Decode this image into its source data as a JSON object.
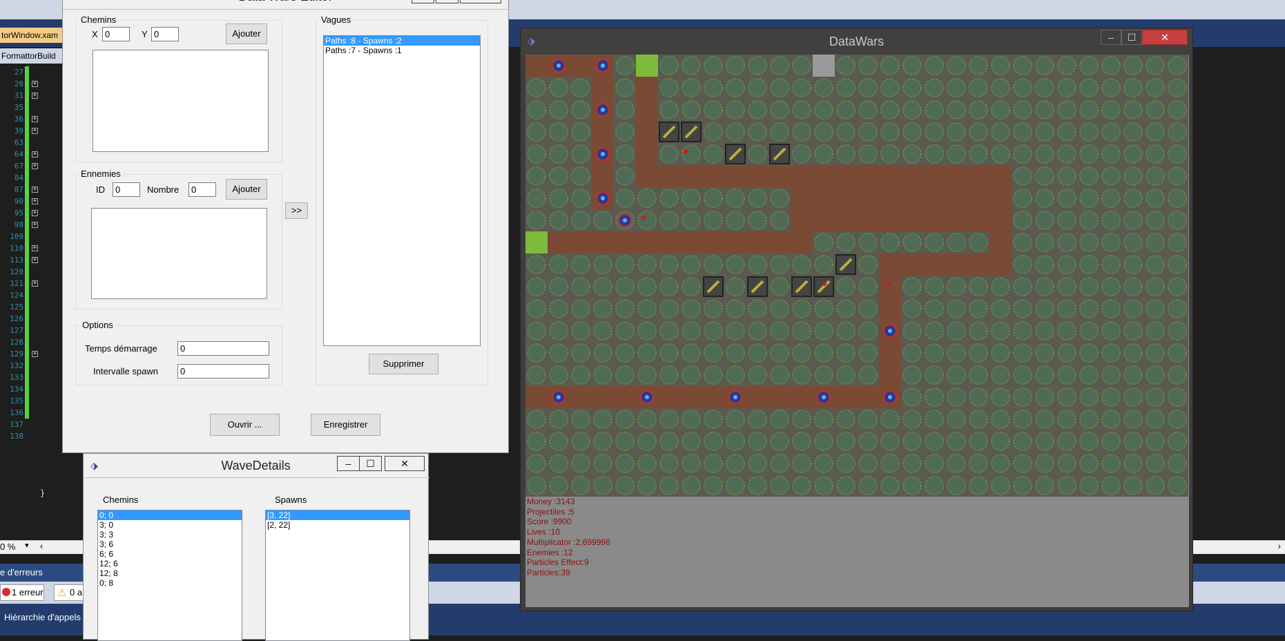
{
  "ide": {
    "tabs": [
      "torWindow.xam",
      "FormattorBuild"
    ],
    "line_numbers": [
      "27",
      "28",
      "31",
      "35",
      "36",
      "39",
      "63",
      "64",
      "67",
      "84",
      "87",
      "90",
      "95",
      "98",
      "109",
      "110",
      "113",
      "120",
      "121",
      "124",
      "125",
      "126",
      "127",
      "128",
      "129",
      "132",
      "133",
      "134",
      "135",
      "136",
      "137",
      "138"
    ],
    "closing_brace": "}",
    "zoom": "0 %",
    "errors_panel_title": "e d'erreurs",
    "errors_button": "1 erreur",
    "warnings_button": "0 a",
    "call_hierarchy": "Hiérarchie d'appels"
  },
  "editor": {
    "title": "Data Wars Editor",
    "chemins": {
      "label": "Chemins",
      "x_label": "X",
      "x_value": "0",
      "y_label": "Y",
      "y_value": "0",
      "add_button": "Ajouter"
    },
    "ennemies": {
      "label": "Ennemies",
      "id_label": "ID",
      "id_value": "0",
      "count_label": "Nombre",
      "count_value": "0",
      "add_button": "Ajouter"
    },
    "transfer_button": ">>",
    "options": {
      "label": "Options",
      "start_time_label": "Temps démarrage",
      "start_time_value": "0",
      "spawn_interval_label": "Intervalle spawn",
      "spawn_interval_value": "0"
    },
    "vagues": {
      "label": "Vagues",
      "items": [
        "Paths :8 - Spawns :2",
        "Paths :7 - Spawns :1"
      ],
      "selected_index": 0,
      "delete_button": "Supprimer"
    },
    "open_button": "Ouvrir ...",
    "save_button": "Enregistrer"
  },
  "wave_details": {
    "title": "WaveDetails",
    "chemins_label": "Chemins",
    "chemins": [
      "0; 0",
      "3; 0",
      "3; 3",
      "3; 6",
      "6; 6",
      "12; 6",
      "12; 8",
      "0; 8"
    ],
    "spawns_label": "Spawns",
    "spawns": [
      "[3, 22]",
      "[2, 22]"
    ],
    "selected_index": 0
  },
  "datawars": {
    "title": "DataWars",
    "stats": [
      "Money :3143",
      "Projectiles :5",
      "Score :9900",
      "Lives :10",
      "Multiplicator :2,699998",
      "Enemies :12",
      "Particles Effect:9",
      "Particles:39"
    ]
  },
  "colors": {
    "grass": "#4f6b55",
    "path": "#7a4a34",
    "spawn": "#7dbb3c",
    "selection": "#3399ff",
    "stats_text": "#8a1010",
    "ide_blue": "#233c6d"
  },
  "icons": [
    "minimize-icon",
    "maximize-icon",
    "close-icon",
    "app-icon",
    "error-icon",
    "warning-icon"
  ]
}
